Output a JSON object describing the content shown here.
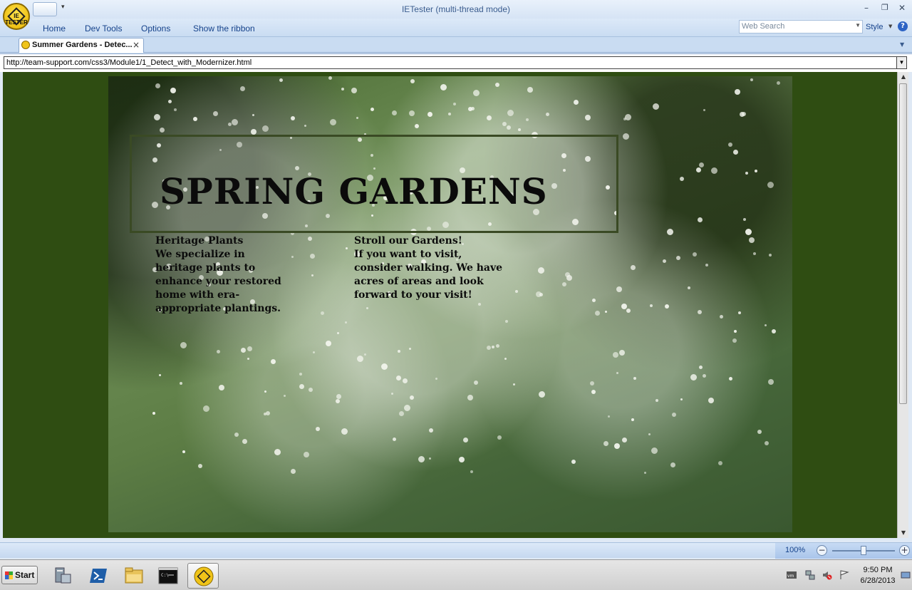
{
  "window": {
    "title": "IETester (multi-thread mode)",
    "logo_text": "IE TESTER",
    "minimize": "–",
    "maximize": "❐",
    "close": "✕"
  },
  "ribbon": {
    "menu": [
      "Home",
      "Dev Tools",
      "Options",
      "Show the ribbon"
    ],
    "search_placeholder": "Web Search",
    "style_label": "Style",
    "help": "?"
  },
  "tabs": [
    {
      "title": "Summer Gardens - Detec...",
      "close": "×"
    }
  ],
  "address": {
    "url": "http://team-support.com/css3/Module1/1_Detect_with_Modernizer.html"
  },
  "page": {
    "title": "SPRING GARDENS",
    "columns": [
      {
        "heading": "Heritage Plants",
        "text": "We specialize in heritage plants to enhance your restored home with era-appropriate plantings."
      },
      {
        "heading": "Stroll our Gardens!",
        "text": "If you want to visit, consider walking. We have acres of areas and look forward to your visit!"
      }
    ]
  },
  "status": {
    "zoom": "100%",
    "zoom_level": 1.0
  },
  "taskbar": {
    "start_label": "Start",
    "time": "9:50 PM",
    "date": "6/28/2013",
    "apps": [
      "server-manager-icon",
      "powershell-icon",
      "folder-icon",
      "cmd-icon",
      "ietester-icon"
    ]
  },
  "colors": {
    "page_background": "#2f4d12",
    "ribbon_text": "#15428b"
  }
}
